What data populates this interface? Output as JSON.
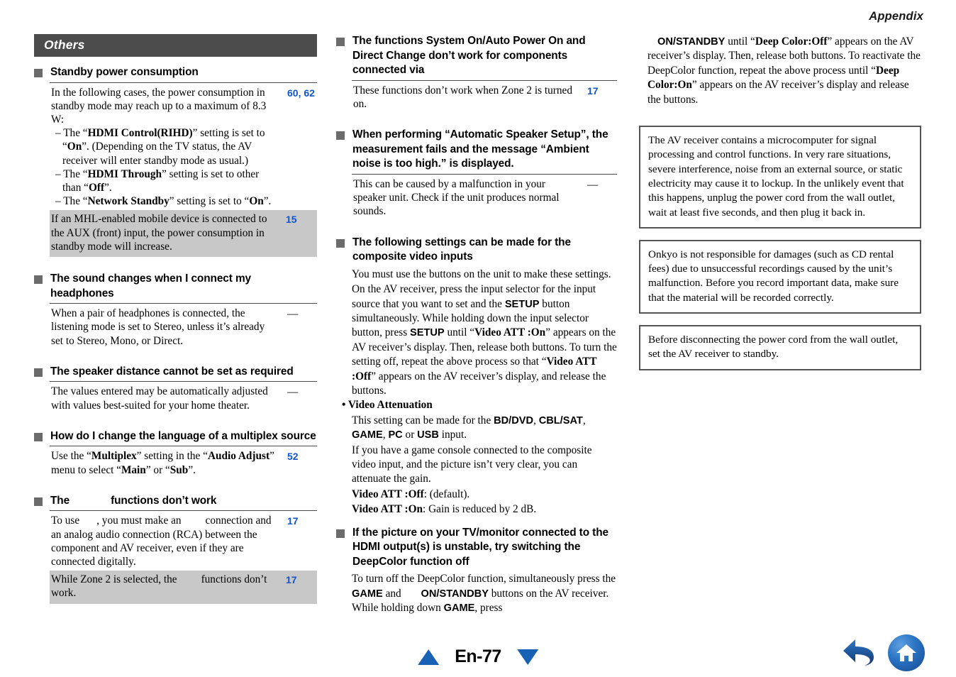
{
  "header": {
    "chapter": "Appendix"
  },
  "colors": {
    "band_bg": "#4c4c4c",
    "ref_blue": "#1155cc",
    "shade": "#c8c8c8",
    "nav_blue": "#1762b5"
  },
  "column1": {
    "band_label": "Others",
    "sections": [
      {
        "heading": "Standby power consumption",
        "rows": [
          {
            "line1": "In the following cases, the power consumption in",
            "line2": "standby mode may reach up to a maximum of 8.3 W:",
            "sub1a": "– The “",
            "sub1b": "HDMI Control(RIHD)",
            "sub1c": "” setting is set to",
            "sub2a": "“",
            "sub2b": "On",
            "sub2c": "”. (Depending on the TV status, the AV",
            "sub3": "receiver will enter standby mode as usual.)",
            "sub4a": "– The “",
            "sub4b": "HDMI Through",
            "sub4c": "” setting is set to other than",
            "sub5a": "“",
            "sub5b": "Off",
            "sub5c": "”.",
            "sub6a": "– The “",
            "sub6b": "Network Standby",
            "sub6c": "” setting is set to “",
            "sub6d": "On",
            "sub6e": "”.",
            "ref": "60, 62"
          },
          {
            "text": "If an MHL-enabled mobile device is connected to the AUX (front) input, the power consumption in standby mode will increase.",
            "ref": "15"
          }
        ]
      },
      {
        "heading": "The sound changes when I connect my headphones",
        "rows": [
          {
            "text": "When a pair of headphones is connected, the listening mode is set to Stereo, unless it’s already set to Stereo, Mono, or Direct.",
            "ref": "—"
          }
        ]
      },
      {
        "heading": "The speaker distance cannot be set as required",
        "rows": [
          {
            "text": "The values entered may be automatically adjusted with values best-suited for your home theater.",
            "ref": "—"
          }
        ]
      },
      {
        "heading": "How do I change the language of a multiplex source",
        "rows": [
          {
            "a": "Use the “",
            "b": "Multiplex",
            "c": "” setting in the “",
            "d": "Audio Adjust",
            "e": "”",
            "f": "menu to select “",
            "g": "Main",
            "h": "” or “",
            "i": "Sub",
            "j": "”.",
            "ref": "52"
          }
        ]
      },
      {
        "heading_a": "The",
        "heading_b": "functions don’t work",
        "rows": [
          {
            "l1a": "To use",
            "l1b": ", you must make an",
            "l1c": "connection and an",
            "l2": "analog audio connection (RCA) between the",
            "l3": "component and AV receiver, even if they are",
            "l4": "connected digitally.",
            "ref": "17"
          },
          {
            "s1a": "While Zone 2 is selected, the",
            "s1b": "functions don’t",
            "s2": "work.",
            "ref": "17"
          }
        ]
      }
    ]
  },
  "column2": {
    "sec1": {
      "heading": "The functions System On/Auto Power On and Direct Change don’t work for components connected via",
      "answer": "These functions don’t work when Zone 2 is turned on.",
      "ref": "17"
    },
    "sec2": {
      "heading": "When performing “Automatic Speaker Setup”, the measurement fails and the message “Ambient noise is too high.” is displayed.",
      "answer": "This can be caused by a malfunction in your speaker unit. Check if the unit produces normal sounds.",
      "ref": "—"
    },
    "sec3": {
      "heading": "The following settings can be made for the composite video inputs",
      "p1": "You must use the buttons on the unit to make these settings.",
      "p2a": "On the AV receiver, press the input selector for the input source that you want to set and the ",
      "p2_setup1": "SETUP",
      "p2b": " button simultaneously. While holding down the input selector button, press ",
      "p2_setup2": "SETUP",
      "p2c": " until “",
      "p2_att_on": "Video ATT :On",
      "p2d": "” appears on the AV receiver’s display. Then, release both buttons. To turn the setting off, repeat the above process so that “",
      "p2_att_off": "Video ATT :Off",
      "p2e": "” appears on the AV receiver’s display, and release the buttons.",
      "bullet": "• Video Attenuation",
      "p3a": "This setting can be made for the ",
      "p3_bd": "BD/DVD",
      "p3b": ", ",
      "p3_cbl": "CBL/SAT",
      "p3c": ", ",
      "p3_game": "GAME",
      "p3d": ", ",
      "p3_pc": "PC",
      "p3e": " or ",
      "p3_usb": "USB",
      "p3f": " input.",
      "p4": "If you have a game console connected to the composite video input, and the picture isn’t very clear, you can attenuate the gain.",
      "p5_label": "Video ATT :Off",
      "p5_rest": ": (default).",
      "p6_label": "Video ATT :On",
      "p6_rest": ": Gain is reduced by 2 dB."
    },
    "sec4": {
      "heading": "If the picture on your TV/monitor connected to the HDMI output(s) is unstable, try switching the DeepColor function off",
      "p1a": "To turn off the DeepColor function, simultaneously press the ",
      "p1_game1": "GAME",
      "p1b": " and ",
      "p1_onstandby": "ON/STANDBY",
      "p1c": " buttons on the AV receiver. While holding down ",
      "p1_game2": "GAME",
      "p1d": ", press"
    }
  },
  "column3": {
    "cont": {
      "a_onstandby": "ON/STANDBY",
      "b": " until “",
      "c_deepoff": "Deep Color:Off",
      "d": "” appears on the AV receiver’s display. Then, release both buttons. To reactivate the DeepColor function, repeat the above process until “",
      "e_deepon": "Deep Color:On",
      "f": "” appears on the AV receiver’s display and release the buttons."
    },
    "notes": [
      "The AV receiver contains a microcomputer for signal processing and control functions. In very rare situations, severe interference, noise from an external source, or static electricity may cause it to lockup. In the unlikely event that this happens, unplug the power cord from the wall outlet, wait at least five seconds, and then plug it back in.",
      "Onkyo is not responsible for damages (such as CD rental fees) due to unsuccessful recordings caused by the unit’s malfunction. Before you record important data, make sure that the material will be recorded correctly.",
      "Before disconnecting the power cord from the wall outlet, set the AV receiver to standby."
    ]
  },
  "footer": {
    "page_label": "En-77",
    "prev_icon": "triangle-up-icon",
    "next_icon": "triangle-down-icon",
    "back_icon": "back-arrow-icon",
    "home_icon": "home-icon"
  }
}
